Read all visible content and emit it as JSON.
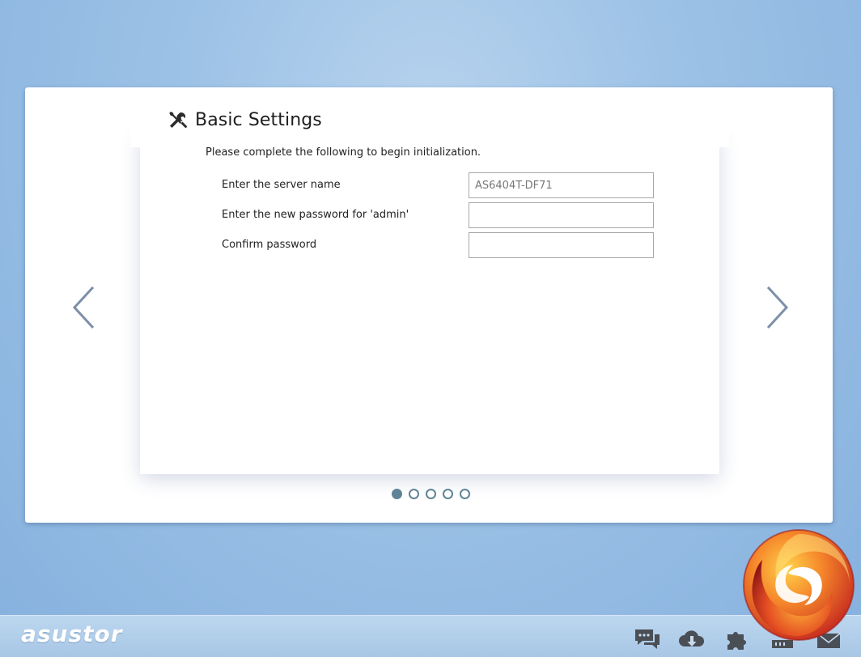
{
  "wizard": {
    "title": "Basic Settings",
    "title_icon": "tools-icon",
    "intro": "Please complete the following to begin initialization.",
    "fields": [
      {
        "label": "Enter the server name",
        "value": "AS6404T-DF71",
        "type": "text"
      },
      {
        "label": "Enter the new password for 'admin'",
        "value": "",
        "type": "password"
      },
      {
        "label": "Confirm password",
        "value": "",
        "type": "password"
      }
    ],
    "steps": {
      "current": 1,
      "total": 5
    },
    "prev_icon": "chevron-left-icon",
    "next_icon": "chevron-right-icon"
  },
  "taskbar": {
    "logo": "asustor",
    "icons": [
      "chat-icon",
      "cloud-download-icon",
      "plugin-icon",
      "storage-icon",
      "mail-icon"
    ]
  },
  "colors": {
    "background": "#9dc2e6",
    "step_dot": "#5f8396",
    "arrow": "#7d8fa8",
    "taskbar_icon": "#4a4f55"
  }
}
